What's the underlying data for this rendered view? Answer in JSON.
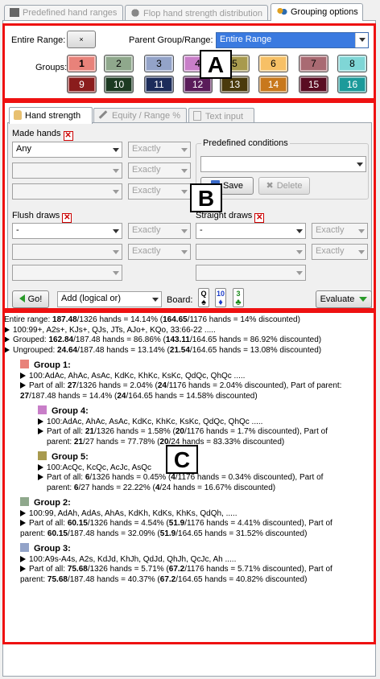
{
  "top_tabs": [
    {
      "label": "Predefined hand ranges"
    },
    {
      "label": "Flop hand strength distribution"
    },
    {
      "label": "Grouping options"
    }
  ],
  "header": {
    "entire_range_label": "Entire Range:",
    "entire_range_btn": "×",
    "parent_label": "Parent Group/Range:",
    "parent_value": "Entire Range",
    "groups_label": "Groups:"
  },
  "groups": [
    {
      "n": "1",
      "color": "#e8827a"
    },
    {
      "n": "2",
      "color": "#8fa88c"
    },
    {
      "n": "3",
      "color": "#93a3c8"
    },
    {
      "n": "4",
      "color": "#c87ec8"
    },
    {
      "n": "5",
      "color": "#a89a4e"
    },
    {
      "n": "6",
      "color": "#f7c066"
    },
    {
      "n": "7",
      "color": "#a96a72"
    },
    {
      "n": "8",
      "color": "#7fd6d6"
    },
    {
      "n": "9",
      "color": "#8a1c1c"
    },
    {
      "n": "10",
      "color": "#1c3a22"
    },
    {
      "n": "11",
      "color": "#1c2c5a"
    },
    {
      "n": "12",
      "color": "#5a1c5a"
    },
    {
      "n": "13",
      "color": "#4a3a0c"
    },
    {
      "n": "14",
      "color": "#c8781c"
    },
    {
      "n": "15",
      "color": "#5a0c22"
    },
    {
      "n": "16",
      "color": "#1c9a9a"
    }
  ],
  "inner_tabs": [
    "Hand strength",
    "Equity / Range %",
    "Text input"
  ],
  "made_hands": {
    "label": "Made hands",
    "row1": "Any",
    "exact": "Exactly"
  },
  "predefined": {
    "label": "Predefined conditions",
    "save": "Save",
    "delete": "Delete"
  },
  "flush": {
    "label": "Flush draws",
    "value": "-",
    "exact": "Exactly"
  },
  "straight": {
    "label": "Straight draws",
    "value": "-",
    "exact": "Exactly"
  },
  "bottom": {
    "go": "Go!",
    "add": "Add (logical or)",
    "board_label": "Board:",
    "evaluate": "Evaluate"
  },
  "board_cards": [
    {
      "rank": "Q",
      "suit": "♠",
      "color": "#000"
    },
    {
      "rank": "10",
      "suit": "♦",
      "color": "#1c3cc8"
    },
    {
      "rank": "3",
      "suit": "♣",
      "color": "#1a8a1a"
    }
  ],
  "annotations": {
    "a": "A",
    "b": "B",
    "c": "C"
  },
  "results": {
    "entire_pre": "Entire range: ",
    "entire_b1": "187.48",
    "entire_mid": "/1326 hands = 14.14%  (",
    "entire_b2": "164.65",
    "entire_post": "/1176 hands = 14% discounted)",
    "line2": "100:99+, A2s+, KJs+, QJs, JTs, AJo+, KQo, 33:66-22 .....",
    "grouped_pre": "Grouped: ",
    "grouped_b1": "162.84",
    "grouped_mid": "/187.48 hands = 86.86%  (",
    "grouped_b2": "143.11",
    "grouped_post": "/164.65 hands = 86.92% discounted)",
    "ungrouped_pre": "Ungrouped: ",
    "ungrouped_b1": "24.64",
    "ungrouped_mid": "/187.48 hands = 13.14%  (",
    "ungrouped_b2": "21.54",
    "ungrouped_post": "/164.65 hands = 13.08% discounted)",
    "g1": {
      "title": "Group 1:",
      "range": "100:AdAc, AhAc, AsAc, KdKc, KhKc, KsKc, QdQc, QhQc .....",
      "p_pre": "Part of all: ",
      "p_b1": "27",
      "p_mid": "/1326 hands = 2.04%  (",
      "p_b2": "24",
      "p_post": "/1176 hands = 2.04% discounted), Part of parent:",
      "q_b1": "27",
      "q_mid": "/187.48 hands = 14.4%  (",
      "q_b2": "24",
      "q_post": "/164.65 hands = 14.58% discounted)"
    },
    "g4": {
      "title": "Group 4:",
      "range": "100:AdAc, AhAc, AsAc, KdKc, KhKc, KsKc, QdQc, QhQc .....",
      "p_pre": "Part of all: ",
      "p_b1": "21",
      "p_mid": "/1326 hands = 1.58%  (",
      "p_b2": "20",
      "p_post": "/1176 hands = 1.7% discounted), Part of",
      "q_pre": "parent: ",
      "q_b1": "21",
      "q_mid": "/27 hands = 77.78%  (",
      "q_b2": "20",
      "q_post": "/24 hands = 83.33% discounted)"
    },
    "g5": {
      "title": "Group 5:",
      "range": "100:AcQc, KcQc, AcJc, AsQc",
      "p_pre": "Part of all: ",
      "p_b1": "6",
      "p_mid": "/1326 hands = 0.45%  (",
      "p_b2": "4",
      "p_post": "/1176 hands = 0.34% discounted), Part of",
      "q_pre": "parent: ",
      "q_b1": "6",
      "q_mid": "/27 hands = 22.22%  (",
      "q_b2": "4",
      "q_post": "/24 hands = 16.67% discounted)"
    },
    "g2": {
      "title": "Group 2:",
      "range": "100:99, AdAh, AdAs, AhAs, KdKh, KdKs, KhKs, QdQh,  .....",
      "p_pre": "Part of all: ",
      "p_b1": "60.15",
      "p_mid": "/1326 hands = 4.54%  (",
      "p_b2": "51.9",
      "p_post": "/1176 hands = 4.41% discounted), Part of",
      "q_pre": "parent: ",
      "q_b1": "60.15",
      "q_mid": "/187.48 hands = 32.09%  (",
      "q_b2": "51.9",
      "q_post": "/164.65 hands = 31.52% discounted)"
    },
    "g3": {
      "title": "Group 3:",
      "range": "100:A9s-A4s, A2s, KdJd, KhJh, QdJd, QhJh, QcJc, Ah .....",
      "p_pre": "Part of all: ",
      "p_b1": "75.68",
      "p_mid": "/1326 hands = 5.71%  (",
      "p_b2": "67.2",
      "p_post": "/1176 hands = 5.71% discounted), Part of",
      "q_pre": "parent: ",
      "q_b1": "75.68",
      "q_mid": "/187.48 hands = 40.37%  (",
      "q_b2": "67.2",
      "q_post": "/164.65 hands = 40.82% discounted)"
    }
  }
}
